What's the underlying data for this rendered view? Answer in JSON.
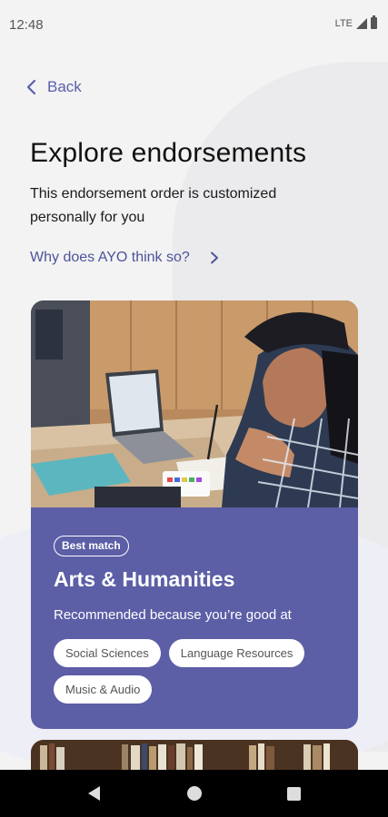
{
  "status_bar": {
    "time": "12:48",
    "network": "LTE"
  },
  "nav": {
    "back_label": "Back"
  },
  "header": {
    "title": "Explore endorsements",
    "subtitle": "This endorsement order is customized personally for you",
    "why_link": "Why does AYO think so?"
  },
  "card": {
    "badge": "Best match",
    "title": "Arts & Humanities",
    "reason": "Recommended because you’re good at",
    "chips": [
      "Social Sciences",
      "Language Resources",
      "Music & Audio"
    ]
  },
  "colors": {
    "accent": "#5c5ea6",
    "link": "#4d5499",
    "background": "#f3f3f4"
  }
}
